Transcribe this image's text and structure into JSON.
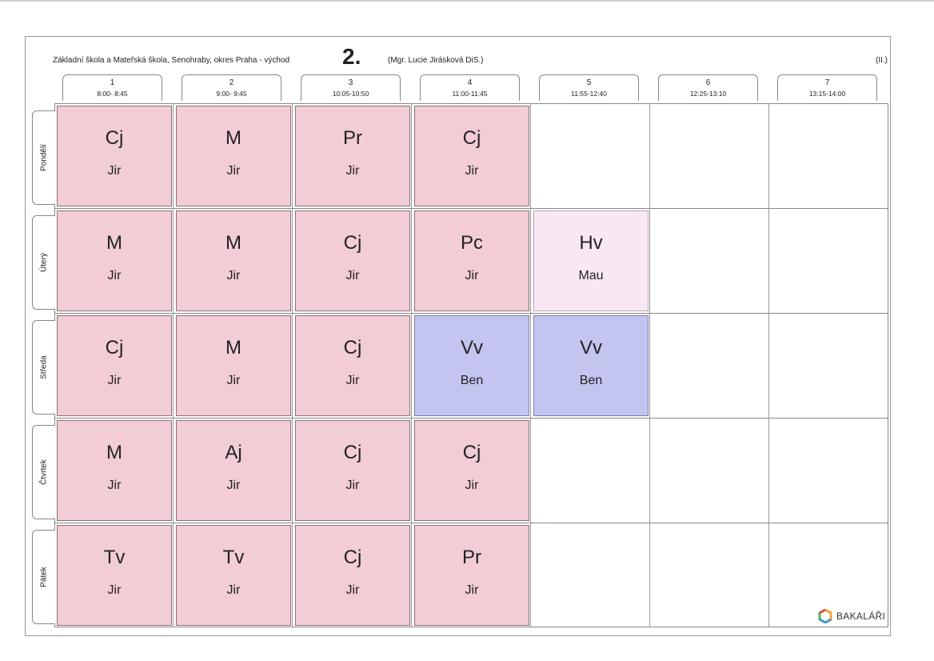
{
  "header": {
    "school": "Základní škola a Mateřská škola, Senohraby, okres Praha - východ",
    "class_name": "2.",
    "teacher": "(Mgr. Lucie Jirásková DiS.)",
    "term": "(II.)"
  },
  "periods": [
    {
      "num": "1",
      "time": "8:00- 8:45"
    },
    {
      "num": "2",
      "time": "9:00- 9:45"
    },
    {
      "num": "3",
      "time": "10:05-10:50"
    },
    {
      "num": "4",
      "time": "11:00-11:45"
    },
    {
      "num": "5",
      "time": "11:55-12:40"
    },
    {
      "num": "6",
      "time": "12:25-13:10"
    },
    {
      "num": "7",
      "time": "13:15-14:00"
    }
  ],
  "days": [
    "Pondělí",
    "Úterý",
    "Středa",
    "Čtvrtek",
    "Pátek"
  ],
  "lessons": [
    [
      {
        "subject": "Cj",
        "teacher": "Jir",
        "style": "pink"
      },
      {
        "subject": "M",
        "teacher": "Jir",
        "style": "pink"
      },
      {
        "subject": "Pr",
        "teacher": "Jir",
        "style": "pink"
      },
      {
        "subject": "Cj",
        "teacher": "Jir",
        "style": "pink"
      }
    ],
    [
      {
        "subject": "M",
        "teacher": "Jir",
        "style": "pink"
      },
      {
        "subject": "M",
        "teacher": "Jir",
        "style": "pink"
      },
      {
        "subject": "Cj",
        "teacher": "Jir",
        "style": "pink"
      },
      {
        "subject": "Pc",
        "teacher": "Jir",
        "style": "pink"
      },
      {
        "subject": "Hv",
        "teacher": "Mau",
        "style": "light"
      }
    ],
    [
      {
        "subject": "Cj",
        "teacher": "Jir",
        "style": "pink"
      },
      {
        "subject": "M",
        "teacher": "Jir",
        "style": "pink"
      },
      {
        "subject": "Cj",
        "teacher": "Jir",
        "style": "pink"
      },
      {
        "subject": "Vv",
        "teacher": "Ben",
        "style": "blue"
      },
      {
        "subject": "Vv",
        "teacher": "Ben",
        "style": "blue"
      }
    ],
    [
      {
        "subject": "M",
        "teacher": "Jir",
        "style": "pink"
      },
      {
        "subject": "Aj",
        "teacher": "Jir",
        "style": "pink"
      },
      {
        "subject": "Cj",
        "teacher": "Jir",
        "style": "pink"
      },
      {
        "subject": "Cj",
        "teacher": "Jir",
        "style": "pink"
      }
    ],
    [
      {
        "subject": "Tv",
        "teacher": "Jir",
        "style": "pink"
      },
      {
        "subject": "Tv",
        "teacher": "Jir",
        "style": "pink"
      },
      {
        "subject": "Cj",
        "teacher": "Jir",
        "style": "pink"
      },
      {
        "subject": "Pr",
        "teacher": "Jir",
        "style": "pink"
      }
    ]
  ],
  "colors": {
    "pink": "#f2cdd5",
    "light": "#f8e8f3",
    "blue": "#c3c4ef"
  },
  "logo": {
    "text": "BAKALÁŘI",
    "icon": "bakalari-hexagon-icon"
  }
}
